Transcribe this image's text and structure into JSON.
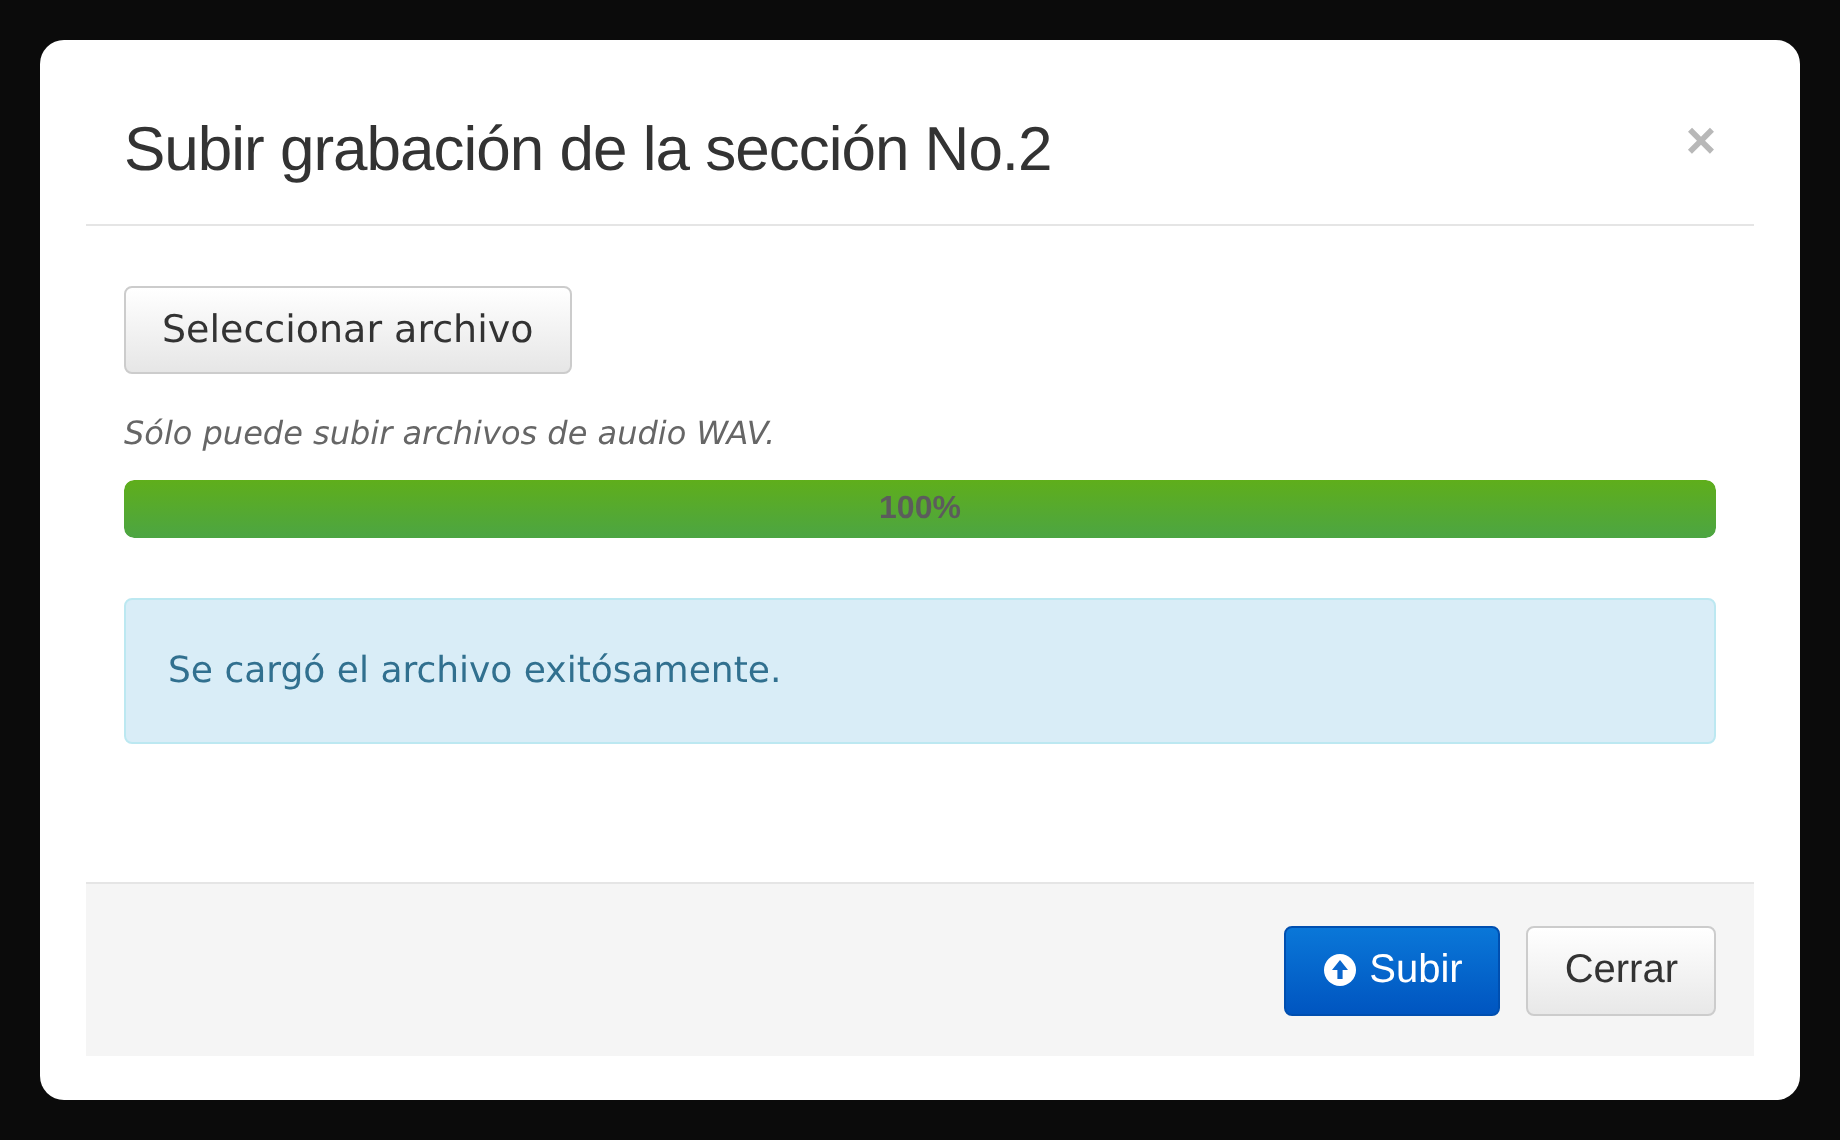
{
  "dialog": {
    "title": "Subir grabación de la sección No.2",
    "close": "×"
  },
  "file_button": {
    "label": "Seleccionar archivo"
  },
  "hint": "Sólo puede subir archivos de audio WAV.",
  "progress": {
    "level": 1,
    "reading": "100%"
  },
  "alert": {
    "text": "Se cargó el archivo exitósamente."
  },
  "buttons": [
    {
      "label": "Subir",
      "kind": "primary"
    },
    {
      "label": "Cerrar",
      "kind": "default"
    }
  ]
}
